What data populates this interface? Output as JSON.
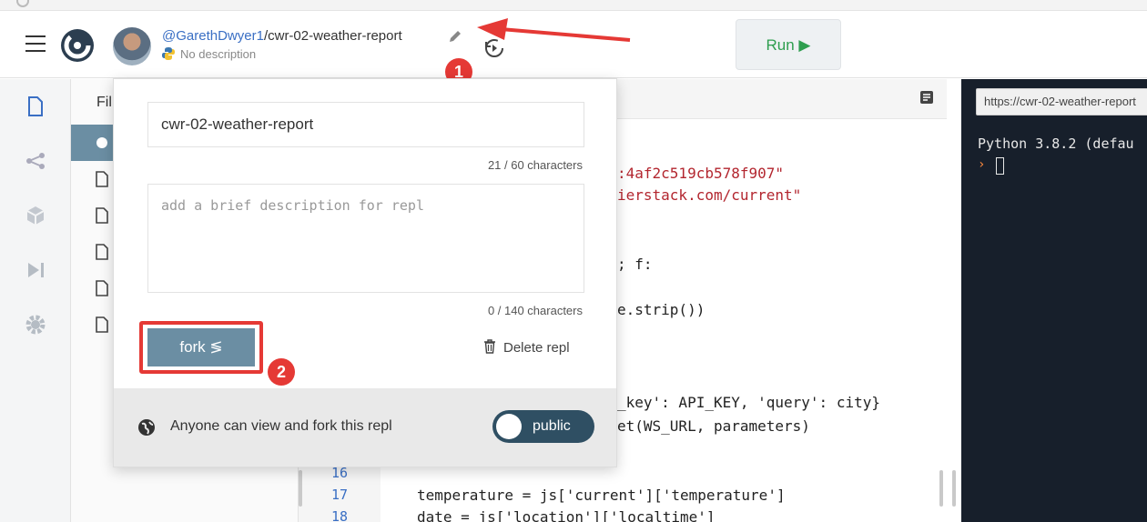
{
  "header": {
    "repl_owner": "@GarethDwyer1",
    "repl_separator": "/",
    "repl_name": "cwr-02-weather-report",
    "description": "No description",
    "run_label": "Run ▶"
  },
  "annotations": {
    "badge1": "1",
    "badge2": "2",
    "accent_color": "#e53935"
  },
  "sidebar": {
    "files_title": "Fil"
  },
  "popover": {
    "name_value": "cwr-02-weather-report",
    "name_count": "21 / 60 characters",
    "desc_placeholder": "add a brief description for repl",
    "desc_count": "0 / 140 characters",
    "fork_label": "fork ≶",
    "delete_label": "Delete repl",
    "footer_text": "Anyone can view and fork this repl",
    "visibility_label": "public"
  },
  "editor": {
    "lines": [
      {
        "a": "",
        "s": ":4af2c519cb578f907\""
      },
      {
        "a": "",
        "s": "ierstack.com/current\""
      },
      {
        "a": "; f:",
        "s": ""
      },
      {
        "a": "e.strip())",
        "s": ""
      },
      {
        "a": "_key': API_KEY, 'query': city}",
        "s": ""
      },
      {
        "a": "et(WS_URL, parameters)",
        "s": ""
      }
    ],
    "line_16_num": "16",
    "line_17_num": "17",
    "line_17_code": "temperature = js['current']['temperature']",
    "line_18_num": "18",
    "line_18_code": "date = js['location']['localtime']"
  },
  "console": {
    "url": "https://cwr-02-weather-report",
    "banner": "Python 3.8.2 (defau"
  }
}
